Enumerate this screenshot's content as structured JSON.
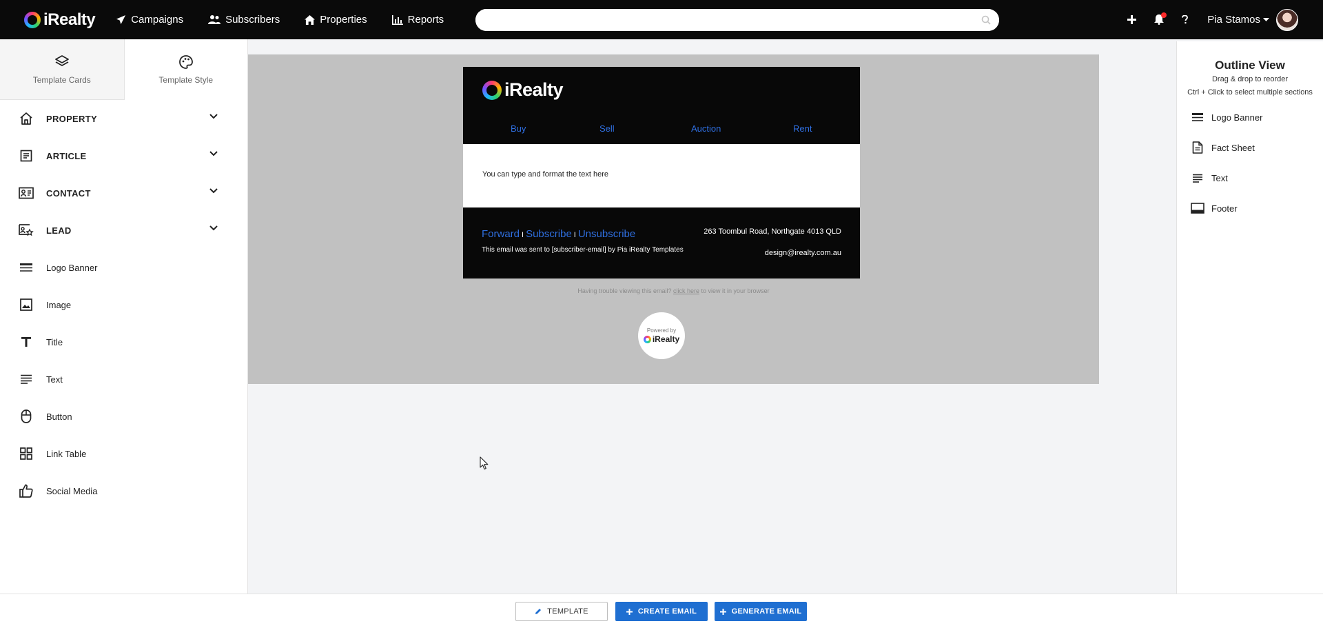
{
  "app": {
    "brand": "iRealty"
  },
  "topnav": {
    "items": [
      {
        "label": "Campaigns",
        "icon": "paper-plane-icon"
      },
      {
        "label": "Subscribers",
        "icon": "users-icon"
      },
      {
        "label": "Properties",
        "icon": "home-icon"
      },
      {
        "label": "Reports",
        "icon": "bar-chart-icon"
      }
    ],
    "search": {
      "value": "",
      "placeholder": ""
    },
    "user_name": "Pia Stamos"
  },
  "leftpanel": {
    "tabs": [
      {
        "label": "Template Cards",
        "icon": "layers-icon"
      },
      {
        "label": "Template Style",
        "icon": "palette-icon"
      }
    ],
    "groups": [
      {
        "label": "PROPERTY",
        "icon": "home-icon"
      },
      {
        "label": "ARTICLE",
        "icon": "article-icon"
      },
      {
        "label": "CONTACT",
        "icon": "contact-card-icon"
      },
      {
        "label": "LEAD",
        "icon": "lead-icon"
      }
    ],
    "cards": [
      {
        "label": "Logo Banner",
        "icon": "logo-banner-icon"
      },
      {
        "label": "Image",
        "icon": "image-icon"
      },
      {
        "label": "Title",
        "icon": "title-icon"
      },
      {
        "label": "Text",
        "icon": "text-icon"
      },
      {
        "label": "Button",
        "icon": "mouse-icon"
      },
      {
        "label": "Link Table",
        "icon": "grid-icon"
      },
      {
        "label": "Social Media",
        "icon": "thumbs-up-icon"
      }
    ]
  },
  "email": {
    "logo_text": "iRealty",
    "nav": [
      "Buy",
      "Sell",
      "Auction",
      "Rent"
    ],
    "body_text": "You can type and format the text here",
    "footer": {
      "links": [
        "Forward",
        "Subscribe",
        "Unsubscribe"
      ],
      "separator": "I",
      "sent_text": "This email was sent to [subscriber-email] by Pia iRealty Templates",
      "address": "263 Toombul Road, Northgate 4013 QLD",
      "email": "design@irealty.com.au"
    },
    "trouble_prefix": "Having trouble viewing this email?",
    "trouble_link": "click here",
    "trouble_suffix": "to view it in your browser",
    "powered_by": "Powered by",
    "powered_brand": "iRealty"
  },
  "outline": {
    "title": "Outline View",
    "subtitle": "Drag & drop to reorder",
    "hint": "Ctrl + Click to select multiple sections",
    "items": [
      {
        "label": "Logo Banner",
        "icon": "logo-banner-icon"
      },
      {
        "label": "Fact Sheet",
        "icon": "document-icon"
      },
      {
        "label": "Text",
        "icon": "text-icon"
      },
      {
        "label": "Footer",
        "icon": "footer-icon"
      }
    ]
  },
  "bottombar": {
    "template_label": "TEMPLATE",
    "create_label": "CREATE EMAIL",
    "generate_label": "GENERATE EMAIL"
  },
  "colors": {
    "nav_bg": "#0a0a0a",
    "link_blue": "#2f6fe0",
    "primary_button": "#1f6fd1",
    "canvas_bg": "#c1c1c1"
  }
}
